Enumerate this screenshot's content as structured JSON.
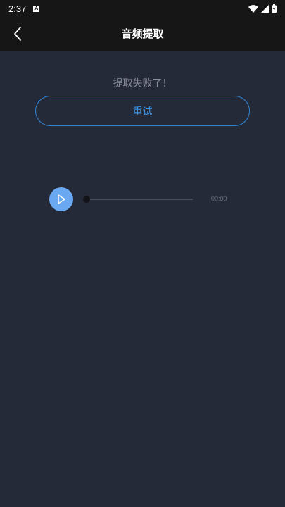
{
  "status_bar": {
    "time": "2:37",
    "notification_icon": "a-box-icon",
    "icons": [
      "wifi-icon",
      "signal-icon",
      "battery-icon"
    ]
  },
  "app_bar": {
    "title": "音频提取",
    "back_icon": "chevron-left-icon"
  },
  "main": {
    "error_message": "提取失败了！",
    "retry_label": "重试"
  },
  "audio_player": {
    "play_icon": "play-icon",
    "progress": 0,
    "time": "00:00"
  },
  "colors": {
    "background": "#252a38",
    "bar_background": "#161616",
    "accent": "#3b95e8",
    "play_button": "#6aa9f2"
  }
}
